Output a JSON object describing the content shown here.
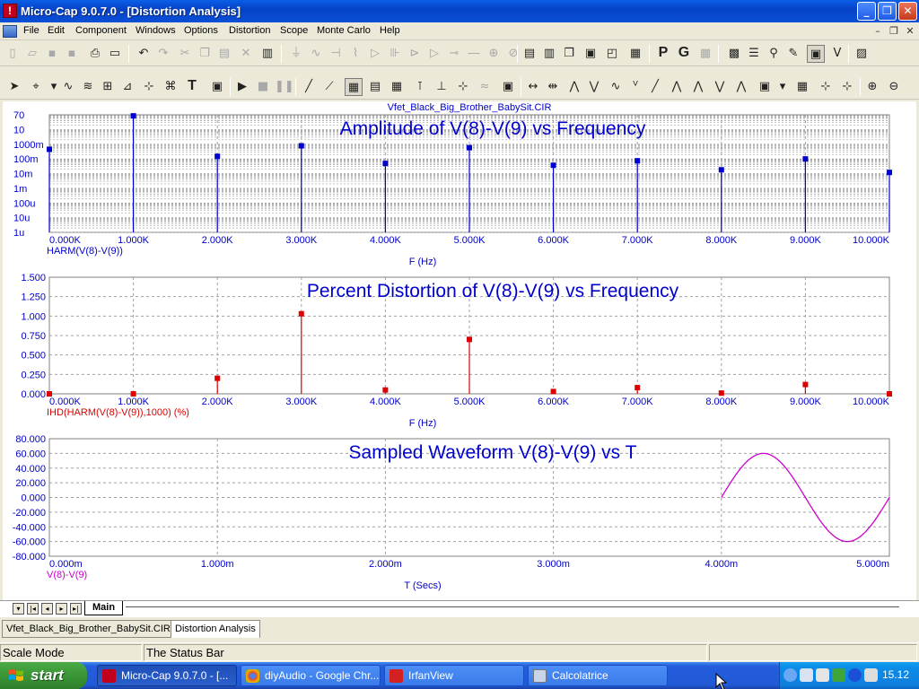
{
  "window": {
    "title": "Micro-Cap 9.0.7.0 - [Distortion Analysis]",
    "controls": {
      "minimize": "_",
      "maximize": "❐",
      "close": "✕"
    }
  },
  "menu": {
    "items": [
      "File",
      "Edit",
      "Component",
      "Windows",
      "Options",
      "Distortion",
      "Scope",
      "Monte Carlo",
      "Help"
    ],
    "mdi_controls": [
      "–",
      "❐",
      "✕"
    ]
  },
  "toolbar": {
    "text_tool": "T",
    "p_button": "P",
    "g_button": "G"
  },
  "plot": {
    "circuit_name": "Vfet_Black_Big_Brother_BabySit.CIR",
    "panels": [
      {
        "title": "Amplitude of V(8)-V(9) vs Frequency",
        "y_ticks": [
          "70",
          "10",
          "1000m",
          "100m",
          "10m",
          "1m",
          "100u",
          "10u",
          "1u"
        ],
        "x_ticks": [
          "0.000K",
          "1.000K",
          "2.000K",
          "3.000K",
          "4.000K",
          "5.000K",
          "6.000K",
          "7.000K",
          "8.000K",
          "9.000K",
          "10.000K"
        ],
        "trace_label": "HARM(V(8)-V(9))",
        "x_axis_label": "F (Hz)"
      },
      {
        "title": "Percent Distortion of V(8)-V(9) vs Frequency",
        "y_ticks": [
          "1.500",
          "1.250",
          "1.000",
          "0.750",
          "0.500",
          "0.250",
          "0.000"
        ],
        "x_ticks": [
          "0.000K",
          "1.000K",
          "2.000K",
          "3.000K",
          "4.000K",
          "5.000K",
          "6.000K",
          "7.000K",
          "8.000K",
          "9.000K",
          "10.000K"
        ],
        "trace_label": "IHD(HARM(V(8)-V(9)),1000) (%)",
        "x_axis_label": "F (Hz)"
      },
      {
        "title": "Sampled Waveform  V(8)-V(9) vs T",
        "y_ticks": [
          "80.000",
          "60.000",
          "40.000",
          "20.000",
          "0.000",
          "-20.000",
          "-40.000",
          "-60.000",
          "-80.000"
        ],
        "x_ticks": [
          "0.000m",
          "1.000m",
          "2.000m",
          "3.000m",
          "4.000m",
          "5.000m"
        ],
        "trace_label": "V(8)-V(9)",
        "x_axis_label": "T (Secs)"
      }
    ],
    "colors": {
      "amplitude": "#0000CC",
      "distortion": "#DD0000",
      "waveform": "#CC00CC",
      "title": "#0000CC",
      "grid": "#A0A0A0"
    }
  },
  "chart_data": [
    {
      "type": "bar",
      "title": "Amplitude of V(8)-V(9) vs Frequency",
      "xlabel": "F (Hz)",
      "ylabel": "",
      "y_scale": "log",
      "xlim": [
        0,
        10000
      ],
      "ylim": [
        1e-06,
        70
      ],
      "grid": true,
      "series": [
        {
          "name": "HARM(V(8)-V(9))",
          "x": [
            0,
            1000,
            2000,
            3000,
            4000,
            5000,
            6000,
            7000,
            8000,
            9000,
            10000
          ],
          "values": [
            0.35,
            60,
            0.12,
            0.6,
            0.04,
            0.45,
            0.03,
            0.06,
            0.015,
            0.08,
            0.01
          ]
        }
      ]
    },
    {
      "type": "bar",
      "title": "Percent Distortion of V(8)-V(9) vs Frequency",
      "xlabel": "F (Hz)",
      "ylabel": "",
      "xlim": [
        0,
        10000
      ],
      "ylim": [
        0,
        1.5
      ],
      "grid": true,
      "series": [
        {
          "name": "IHD(HARM(V(8)-V(9)),1000) (%)",
          "x": [
            0,
            1000,
            2000,
            3000,
            4000,
            5000,
            6000,
            7000,
            8000,
            9000,
            10000
          ],
          "values": [
            0.0,
            0.0,
            0.2,
            1.03,
            0.05,
            0.7,
            0.03,
            0.08,
            0.01,
            0.12,
            0.0
          ]
        }
      ]
    },
    {
      "type": "line",
      "title": "Sampled Waveform  V(8)-V(9) vs T",
      "xlabel": "T (Secs)",
      "ylabel": "",
      "xlim": [
        0,
        0.005
      ],
      "ylim": [
        -80,
        80
      ],
      "grid": true,
      "series": [
        {
          "name": "V(8)-V(9)",
          "x": [
            0.004,
            0.005
          ],
          "amplitude": 60,
          "frequency_hz": 1000
        }
      ]
    }
  ],
  "sheet_tabs": {
    "nav": [
      "▾",
      "|◂",
      "◂",
      "▸",
      "▸|"
    ],
    "active": "Main"
  },
  "document_tabs": [
    "Vfet_Black_Big_Brother_BabySit.CIR",
    "Distortion Analysis"
  ],
  "status_bar": {
    "mode": "Scale Mode",
    "message": "The Status Bar"
  },
  "taskbar": {
    "start_label": "start",
    "items": [
      "Micro-Cap 9.0.7.0 - [...",
      "diyAudio - Google Chr...",
      "IrfanView",
      "Calcolatrice"
    ],
    "clock": "15.12"
  }
}
